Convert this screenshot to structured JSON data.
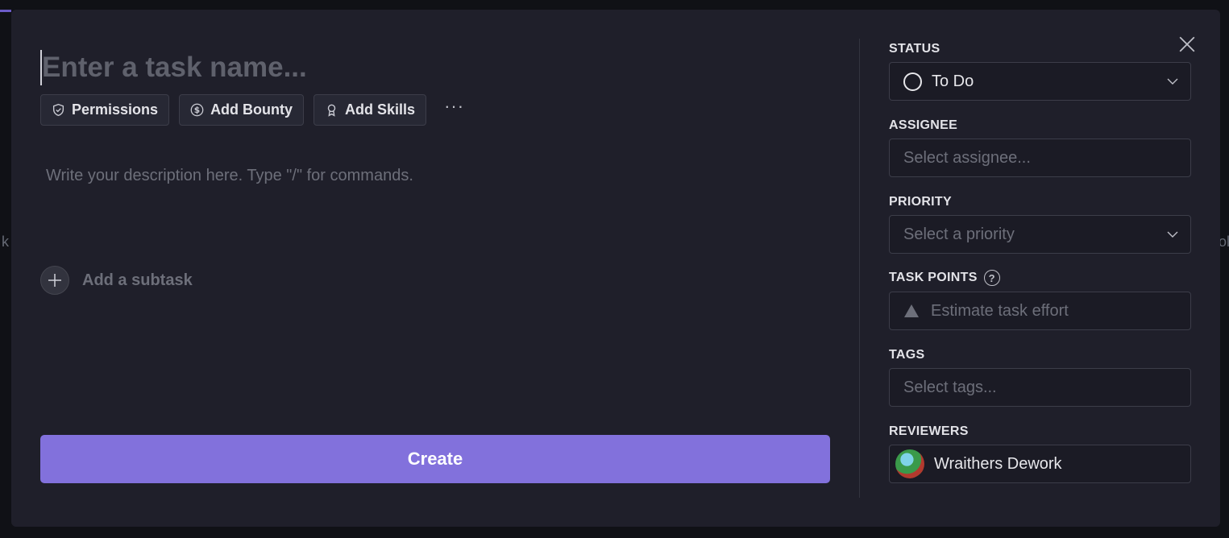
{
  "task": {
    "name_placeholder": "Enter a task name...",
    "description_placeholder": "Write your description here. Type \"/\" for commands.",
    "chips": [
      {
        "label": "Permissions",
        "icon": "shield-icon"
      },
      {
        "label": "Add Bounty",
        "icon": "dollar-icon"
      },
      {
        "label": "Add Skills",
        "icon": "ribbon-icon"
      }
    ],
    "more_label": "···",
    "subtask_label": "Add a subtask",
    "create_label": "Create"
  },
  "sidebar": {
    "status": {
      "label": "STATUS",
      "value": "To Do"
    },
    "assignee": {
      "label": "ASSIGNEE",
      "placeholder": "Select assignee..."
    },
    "priority": {
      "label": "PRIORITY",
      "placeholder": "Select a priority"
    },
    "task_points": {
      "label": "TASK POINTS",
      "placeholder": "Estimate task effort",
      "help": "?"
    },
    "tags": {
      "label": "TAGS",
      "placeholder": "Select tags..."
    },
    "reviewers": {
      "label": "REVIEWERS",
      "value": "Wraithers Dework"
    }
  },
  "colors": {
    "modal_bg": "#1f1f2a",
    "accent": "#8271dc",
    "border": "#3c3d49"
  }
}
